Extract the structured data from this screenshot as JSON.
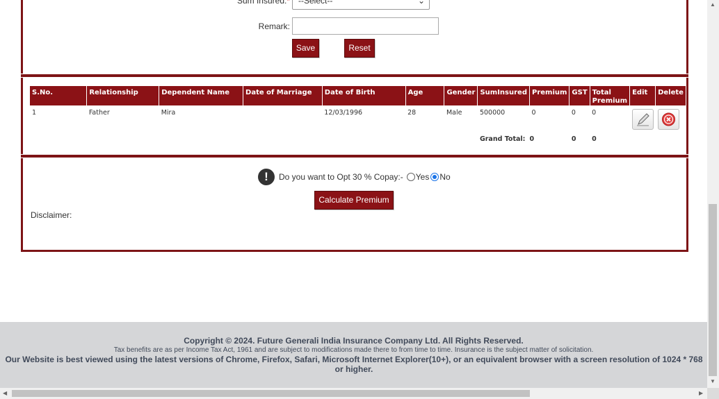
{
  "form": {
    "sum_insured_label": "Sum Insured:",
    "required_mark": "*",
    "sum_insured_value": "--Select--",
    "remark_label": "Remark:",
    "remark_value": "",
    "save_label": "Save",
    "reset_label": "Reset"
  },
  "table": {
    "headers": [
      "S.No.",
      "Relationship",
      "Dependent Name",
      "Date of Marriage",
      "Date of Birth",
      "Age",
      "Gender",
      "SumInsured",
      "Premium",
      "GST",
      "Total Premium",
      "Edit",
      "Delete"
    ],
    "rows": [
      {
        "sno": "1",
        "relationship": "Father",
        "name": "Mira",
        "marriage": "",
        "dob": "12/03/1996",
        "age": "28",
        "gender": "Male",
        "sum_insured": "500000",
        "premium": "0",
        "gst": "0",
        "total": "0"
      }
    ],
    "grand_total_label": "Grand Total:",
    "grand_total_premium": "0",
    "grand_total_gst": "0",
    "grand_total_total": "0"
  },
  "copay": {
    "question": "Do you want to Opt 30 % Copay:-",
    "yes_label": "Yes",
    "no_label": "No",
    "selected": "No"
  },
  "calculate_label": "Calculate Premium",
  "disclaimer_label": "Disclaimer:",
  "footer": {
    "copyright": "Copyright © 2024. Future Generali India Insurance Company Ltd. All Rights Reserved.",
    "tax_note": "Tax benefits are as per Income Tax Act, 1961 and are subject to modifications made there to from time to time. Insurance is the subject matter of solicitation.",
    "browser_note": "Our Website is best viewed using the latest versions of Chrome, Firefox, Safari, Microsoft Internet Explorer(10+), or an equivalent browser with a screen resolution of 1024 * 768 or higher."
  },
  "colors": {
    "brand": "#8b1216",
    "radio_selected": "#1a73e8"
  }
}
